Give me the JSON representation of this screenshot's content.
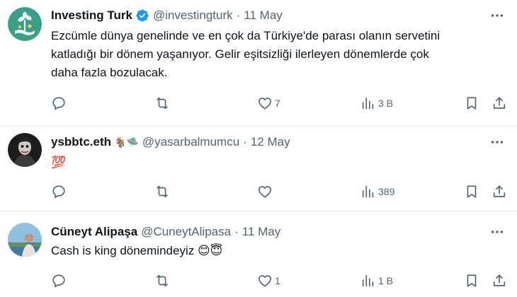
{
  "tweets": [
    {
      "name": "Investing Turk",
      "verified": true,
      "emoji_badges": "",
      "handle": "@investingturk",
      "separator": "·",
      "date": "11 May",
      "text_lines": [
        "Ezcümle dünya genelinde ve en çok da Türkiye'de parası olanın servetini",
        "katladığı bir dönem yaşanıyor. Gelir eşitsizliği ilerleyen dönemlerde çok",
        "daha fazla bozulacak."
      ],
      "replies": "",
      "reposts": "",
      "likes": "7",
      "views": "3 B",
      "avatar_icon": "money-plant-icon"
    },
    {
      "name": "ysbbtc.eth",
      "verified": false,
      "emoji_badges": "🐐🛸",
      "handle": "@yasarbalmumcu",
      "separator": "·",
      "date": "12 May",
      "text_lines": [
        "💯"
      ],
      "replies": "",
      "reposts": "",
      "likes": "",
      "views": "389",
      "avatar_icon": "joker-portrait-icon"
    },
    {
      "name": "Cüneyt Alipaşa",
      "verified": false,
      "emoji_badges": "",
      "handle": "@CuneytAlipasa",
      "separator": "·",
      "date": "11 May",
      "text_lines": [
        "Cash is king dönemindeyiz 😊😇"
      ],
      "replies": "",
      "reposts": "",
      "likes": "1",
      "views": "1 B",
      "avatar_icon": "seaside-portrait-icon"
    }
  ],
  "colors": {
    "text": "#0f1419",
    "secondary": "#536471",
    "verified_blue": "#1d9bf0",
    "divider": "#e6e9ec"
  }
}
